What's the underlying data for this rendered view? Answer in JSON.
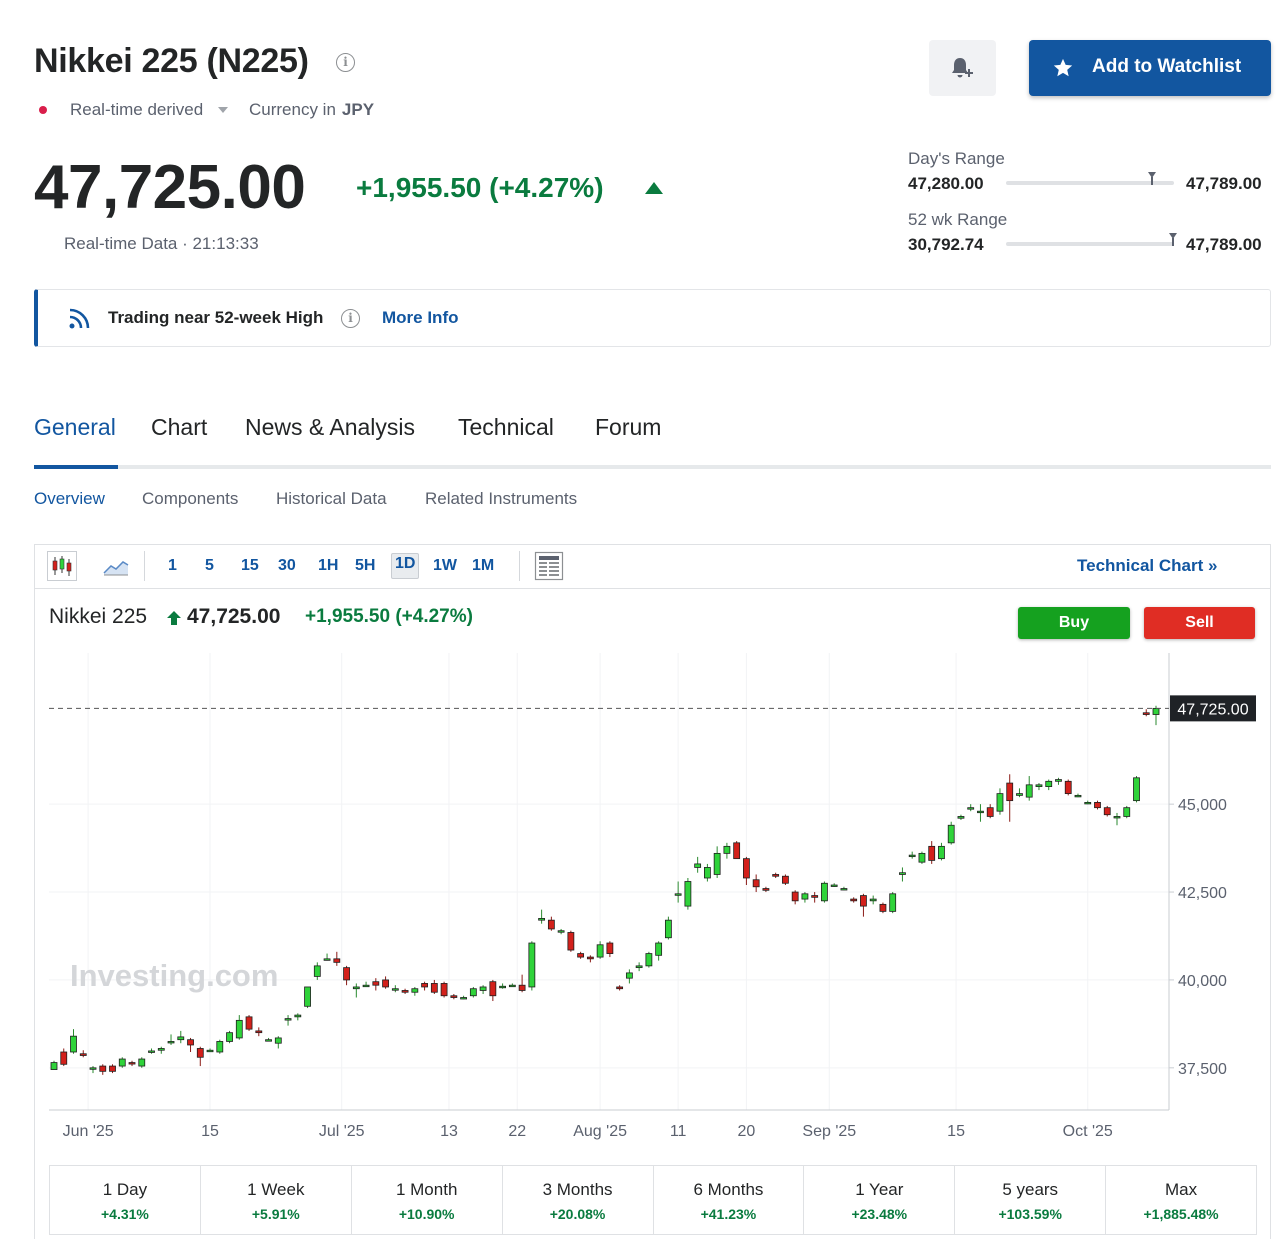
{
  "instrument": {
    "title": "Nikkei 225 (N225)",
    "realtime_label": "Real-time derived",
    "currency_label": "Currency in",
    "currency": "JPY",
    "price": "47,725.00",
    "change": "+1,955.50 (+4.27%)",
    "realtime_data": "Real-time Data · 21:13:33"
  },
  "actions": {
    "watchlist_label": "Add to Watchlist"
  },
  "ranges": {
    "day_label": "Day's Range",
    "day_low": "47,280.00",
    "day_high": "47,789.00",
    "day_position": 0.87,
    "wk52_label": "52 wk Range",
    "wk52_low": "30,792.74",
    "wk52_high": "47,789.00",
    "wk52_position": 0.996
  },
  "banner": {
    "text": "Trading near 52-week High",
    "link": "More Info"
  },
  "tabs": [
    {
      "label": "General"
    },
    {
      "label": "Chart"
    },
    {
      "label": "News & Analysis"
    },
    {
      "label": "Technical"
    },
    {
      "label": "Forum"
    }
  ],
  "subtabs": [
    {
      "label": "Overview"
    },
    {
      "label": "Components"
    },
    {
      "label": "Historical Data"
    },
    {
      "label": "Related Instruments"
    }
  ],
  "toolbar": {
    "timeframes": [
      "1",
      "5",
      "15",
      "30",
      "1H",
      "5H",
      "1D",
      "1W",
      "1M"
    ],
    "active_timeframe": "1D",
    "technical_link": "Technical Chart »"
  },
  "chart_header": {
    "name": "Nikkei 225",
    "price": "47,725.00",
    "change": "+1,955.50",
    "change_pct": "(+4.27%)",
    "buy_label": "Buy",
    "sell_label": "Sell"
  },
  "colors": {
    "up": "#2fd33a",
    "down": "#d3201b",
    "accent": "#1256a0",
    "positive_text": "#0a7b3f"
  },
  "chart_data": {
    "type": "candlestick",
    "watermark": "Investing.com",
    "last_price_label": "47,725.00",
    "last_price": 47725,
    "ylim": [
      36300,
      49300
    ],
    "y_ticks": [
      {
        "value": 37500,
        "label": "37,500"
      },
      {
        "value": 40000,
        "label": "40,000"
      },
      {
        "value": 42500,
        "label": "42,500"
      },
      {
        "value": 45000,
        "label": "45,000"
      }
    ],
    "x_ticks": [
      {
        "index": 3.5,
        "label": "Jun '25"
      },
      {
        "index": 16,
        "label": "15"
      },
      {
        "index": 29.5,
        "label": "Jul '25"
      },
      {
        "index": 40.5,
        "label": "13"
      },
      {
        "index": 47.5,
        "label": "22"
      },
      {
        "index": 56,
        "label": "Aug '25"
      },
      {
        "index": 64,
        "label": "11"
      },
      {
        "index": 71,
        "label": "20"
      },
      {
        "index": 79.5,
        "label": "Sep '25"
      },
      {
        "index": 92.5,
        "label": "15"
      },
      {
        "index": 106,
        "label": "Oct '25"
      }
    ],
    "candles": [
      {
        "o": 37450,
        "h": 37700,
        "l": 37450,
        "c": 37650
      },
      {
        "o": 37950,
        "h": 38050,
        "l": 37550,
        "c": 37600
      },
      {
        "o": 37950,
        "h": 38600,
        "l": 37900,
        "c": 38400
      },
      {
        "o": 37900,
        "h": 38000,
        "l": 37800,
        "c": 37850
      },
      {
        "o": 37500,
        "h": 37550,
        "l": 37350,
        "c": 37500
      },
      {
        "o": 37550,
        "h": 37600,
        "l": 37300,
        "c": 37400
      },
      {
        "o": 37550,
        "h": 37600,
        "l": 37350,
        "c": 37400
      },
      {
        "o": 37550,
        "h": 37800,
        "l": 37500,
        "c": 37750
      },
      {
        "o": 37650,
        "h": 37700,
        "l": 37550,
        "c": 37620
      },
      {
        "o": 37550,
        "h": 37800,
        "l": 37500,
        "c": 37750
      },
      {
        "o": 37950,
        "h": 38050,
        "l": 37900,
        "c": 37980
      },
      {
        "o": 38000,
        "h": 38100,
        "l": 37900,
        "c": 38050
      },
      {
        "o": 38250,
        "h": 38450,
        "l": 38150,
        "c": 38250
      },
      {
        "o": 38300,
        "h": 38550,
        "l": 38200,
        "c": 38380
      },
      {
        "o": 38300,
        "h": 38350,
        "l": 37950,
        "c": 38150
      },
      {
        "o": 38050,
        "h": 38100,
        "l": 37550,
        "c": 37800
      },
      {
        "o": 38000,
        "h": 38050,
        "l": 37950,
        "c": 38000
      },
      {
        "o": 37950,
        "h": 38300,
        "l": 37900,
        "c": 38250
      },
      {
        "o": 38250,
        "h": 38550,
        "l": 38200,
        "c": 38500
      },
      {
        "o": 38350,
        "h": 39000,
        "l": 38300,
        "c": 38850
      },
      {
        "o": 38950,
        "h": 39000,
        "l": 38550,
        "c": 38600
      },
      {
        "o": 38550,
        "h": 38650,
        "l": 38400,
        "c": 38500
      },
      {
        "o": 38300,
        "h": 38350,
        "l": 38250,
        "c": 38300
      },
      {
        "o": 38200,
        "h": 38400,
        "l": 38050,
        "c": 38350
      },
      {
        "o": 38900,
        "h": 39000,
        "l": 38700,
        "c": 38900
      },
      {
        "o": 38950,
        "h": 39050,
        "l": 38850,
        "c": 39000
      },
      {
        "o": 39250,
        "h": 39800,
        "l": 39200,
        "c": 39800
      },
      {
        "o": 40100,
        "h": 40500,
        "l": 40000,
        "c": 40400
      },
      {
        "o": 40600,
        "h": 40750,
        "l": 40550,
        "c": 40600
      },
      {
        "o": 40600,
        "h": 40800,
        "l": 40400,
        "c": 40500
      },
      {
        "o": 40350,
        "h": 40400,
        "l": 39850,
        "c": 40000
      },
      {
        "o": 39750,
        "h": 39900,
        "l": 39500,
        "c": 39800
      },
      {
        "o": 39850,
        "h": 39950,
        "l": 39800,
        "c": 39850
      },
      {
        "o": 39950,
        "h": 40050,
        "l": 39700,
        "c": 39850
      },
      {
        "o": 40000,
        "h": 40100,
        "l": 39750,
        "c": 39800
      },
      {
        "o": 39750,
        "h": 39850,
        "l": 39650,
        "c": 39750
      },
      {
        "o": 39700,
        "h": 39750,
        "l": 39600,
        "c": 39650
      },
      {
        "o": 39650,
        "h": 39800,
        "l": 39550,
        "c": 39750
      },
      {
        "o": 39900,
        "h": 39950,
        "l": 39700,
        "c": 39800
      },
      {
        "o": 39900,
        "h": 40000,
        "l": 39600,
        "c": 39650
      },
      {
        "o": 39900,
        "h": 39950,
        "l": 39500,
        "c": 39550
      },
      {
        "o": 39550,
        "h": 39600,
        "l": 39450,
        "c": 39500
      },
      {
        "o": 39500,
        "h": 39550,
        "l": 39450,
        "c": 39500
      },
      {
        "o": 39550,
        "h": 39800,
        "l": 39500,
        "c": 39750
      },
      {
        "o": 39700,
        "h": 39850,
        "l": 39600,
        "c": 39800
      },
      {
        "o": 39950,
        "h": 40000,
        "l": 39400,
        "c": 39550
      },
      {
        "o": 39800,
        "h": 39900,
        "l": 39750,
        "c": 39820
      },
      {
        "o": 39850,
        "h": 39900,
        "l": 39800,
        "c": 39850
      },
      {
        "o": 39850,
        "h": 40150,
        "l": 39650,
        "c": 39700
      },
      {
        "o": 39800,
        "h": 41100,
        "l": 39700,
        "c": 41050
      },
      {
        "o": 41700,
        "h": 42000,
        "l": 41600,
        "c": 41750
      },
      {
        "o": 41700,
        "h": 41800,
        "l": 41400,
        "c": 41450
      },
      {
        "o": 41400,
        "h": 41450,
        "l": 41300,
        "c": 41400
      },
      {
        "o": 41350,
        "h": 41400,
        "l": 40800,
        "c": 40850
      },
      {
        "o": 40750,
        "h": 40800,
        "l": 40600,
        "c": 40650
      },
      {
        "o": 40650,
        "h": 40700,
        "l": 40500,
        "c": 40600
      },
      {
        "o": 40650,
        "h": 41100,
        "l": 40600,
        "c": 41000
      },
      {
        "o": 41050,
        "h": 41100,
        "l": 40650,
        "c": 40750
      },
      {
        "o": 39800,
        "h": 39850,
        "l": 39700,
        "c": 39750
      },
      {
        "o": 40050,
        "h": 40300,
        "l": 39900,
        "c": 40200
      },
      {
        "o": 40350,
        "h": 40500,
        "l": 40250,
        "c": 40400
      },
      {
        "o": 40400,
        "h": 40800,
        "l": 40350,
        "c": 40750
      },
      {
        "o": 40700,
        "h": 41100,
        "l": 40550,
        "c": 41050
      },
      {
        "o": 41200,
        "h": 41800,
        "l": 41150,
        "c": 41700
      },
      {
        "o": 42450,
        "h": 42800,
        "l": 42200,
        "c": 42450
      },
      {
        "o": 42100,
        "h": 42900,
        "l": 42000,
        "c": 42800
      },
      {
        "o": 43200,
        "h": 43500,
        "l": 43050,
        "c": 43300
      },
      {
        "o": 42900,
        "h": 43300,
        "l": 42800,
        "c": 43200
      },
      {
        "o": 43000,
        "h": 43800,
        "l": 42900,
        "c": 43600
      },
      {
        "o": 43600,
        "h": 43900,
        "l": 43450,
        "c": 43800
      },
      {
        "o": 43900,
        "h": 43950,
        "l": 43450,
        "c": 43450
      },
      {
        "o": 43450,
        "h": 43500,
        "l": 42700,
        "c": 42900
      },
      {
        "o": 42850,
        "h": 43000,
        "l": 42500,
        "c": 42650
      },
      {
        "o": 42600,
        "h": 42650,
        "l": 42500,
        "c": 42550
      },
      {
        "o": 43000,
        "h": 43050,
        "l": 42900,
        "c": 42950
      },
      {
        "o": 42950,
        "h": 43000,
        "l": 42700,
        "c": 42750
      },
      {
        "o": 42500,
        "h": 42550,
        "l": 42150,
        "c": 42250
      },
      {
        "o": 42300,
        "h": 42500,
        "l": 42200,
        "c": 42450
      },
      {
        "o": 42400,
        "h": 42500,
        "l": 42200,
        "c": 42350
      },
      {
        "o": 42250,
        "h": 42800,
        "l": 42200,
        "c": 42750
      },
      {
        "o": 42700,
        "h": 42750,
        "l": 42650,
        "c": 42700
      },
      {
        "o": 42600,
        "h": 42650,
        "l": 42550,
        "c": 42600
      },
      {
        "o": 42300,
        "h": 42350,
        "l": 42200,
        "c": 42250
      },
      {
        "o": 42400,
        "h": 42450,
        "l": 41800,
        "c": 42100
      },
      {
        "o": 42250,
        "h": 42400,
        "l": 42150,
        "c": 42300
      },
      {
        "o": 42150,
        "h": 42200,
        "l": 41900,
        "c": 41950
      },
      {
        "o": 41950,
        "h": 42500,
        "l": 41900,
        "c": 42450
      },
      {
        "o": 43000,
        "h": 43200,
        "l": 42800,
        "c": 43050
      },
      {
        "o": 43550,
        "h": 43650,
        "l": 43450,
        "c": 43550
      },
      {
        "o": 43350,
        "h": 43650,
        "l": 43300,
        "c": 43600
      },
      {
        "o": 43800,
        "h": 43950,
        "l": 43300,
        "c": 43400
      },
      {
        "o": 43450,
        "h": 43900,
        "l": 43400,
        "c": 43800
      },
      {
        "o": 43900,
        "h": 44500,
        "l": 43850,
        "c": 44400
      },
      {
        "o": 44600,
        "h": 44700,
        "l": 44550,
        "c": 44650
      },
      {
        "o": 44900,
        "h": 45000,
        "l": 44800,
        "c": 44900
      },
      {
        "o": 44800,
        "h": 45000,
        "l": 44500,
        "c": 44800
      },
      {
        "o": 44900,
        "h": 45000,
        "l": 44600,
        "c": 44650
      },
      {
        "o": 44800,
        "h": 45450,
        "l": 44700,
        "c": 45300
      },
      {
        "o": 45600,
        "h": 45850,
        "l": 44500,
        "c": 45100
      },
      {
        "o": 45250,
        "h": 45450,
        "l": 45200,
        "c": 45300
      },
      {
        "o": 45200,
        "h": 45800,
        "l": 45100,
        "c": 45550
      },
      {
        "o": 45500,
        "h": 45600,
        "l": 45400,
        "c": 45550
      },
      {
        "o": 45500,
        "h": 45700,
        "l": 45400,
        "c": 45650
      },
      {
        "o": 45650,
        "h": 45750,
        "l": 45550,
        "c": 45700
      },
      {
        "o": 45650,
        "h": 45700,
        "l": 45250,
        "c": 45300
      },
      {
        "o": 45250,
        "h": 45300,
        "l": 45200,
        "c": 45250
      },
      {
        "o": 45050,
        "h": 45100,
        "l": 45000,
        "c": 45050
      },
      {
        "o": 45050,
        "h": 45100,
        "l": 44850,
        "c": 44900
      },
      {
        "o": 44900,
        "h": 44950,
        "l": 44650,
        "c": 44700
      },
      {
        "o": 44650,
        "h": 44750,
        "l": 44400,
        "c": 44650
      },
      {
        "o": 44650,
        "h": 44950,
        "l": 44600,
        "c": 44900
      },
      {
        "o": 45100,
        "h": 45800,
        "l": 45050,
        "c": 45750
      },
      {
        "o": 47600,
        "h": 47700,
        "l": 47500,
        "c": 47550
      },
      {
        "o": 47550,
        "h": 47800,
        "l": 47250,
        "c": 47725
      }
    ]
  },
  "performance": [
    {
      "label": "1 Day",
      "value": "+4.31%"
    },
    {
      "label": "1 Week",
      "value": "+5.91%"
    },
    {
      "label": "1 Month",
      "value": "+10.90%"
    },
    {
      "label": "3 Months",
      "value": "+20.08%"
    },
    {
      "label": "6 Months",
      "value": "+41.23%"
    },
    {
      "label": "1 Year",
      "value": "+23.48%"
    },
    {
      "label": "5 years",
      "value": "+103.59%"
    },
    {
      "label": "Max",
      "value": "+1,885.48%"
    }
  ]
}
